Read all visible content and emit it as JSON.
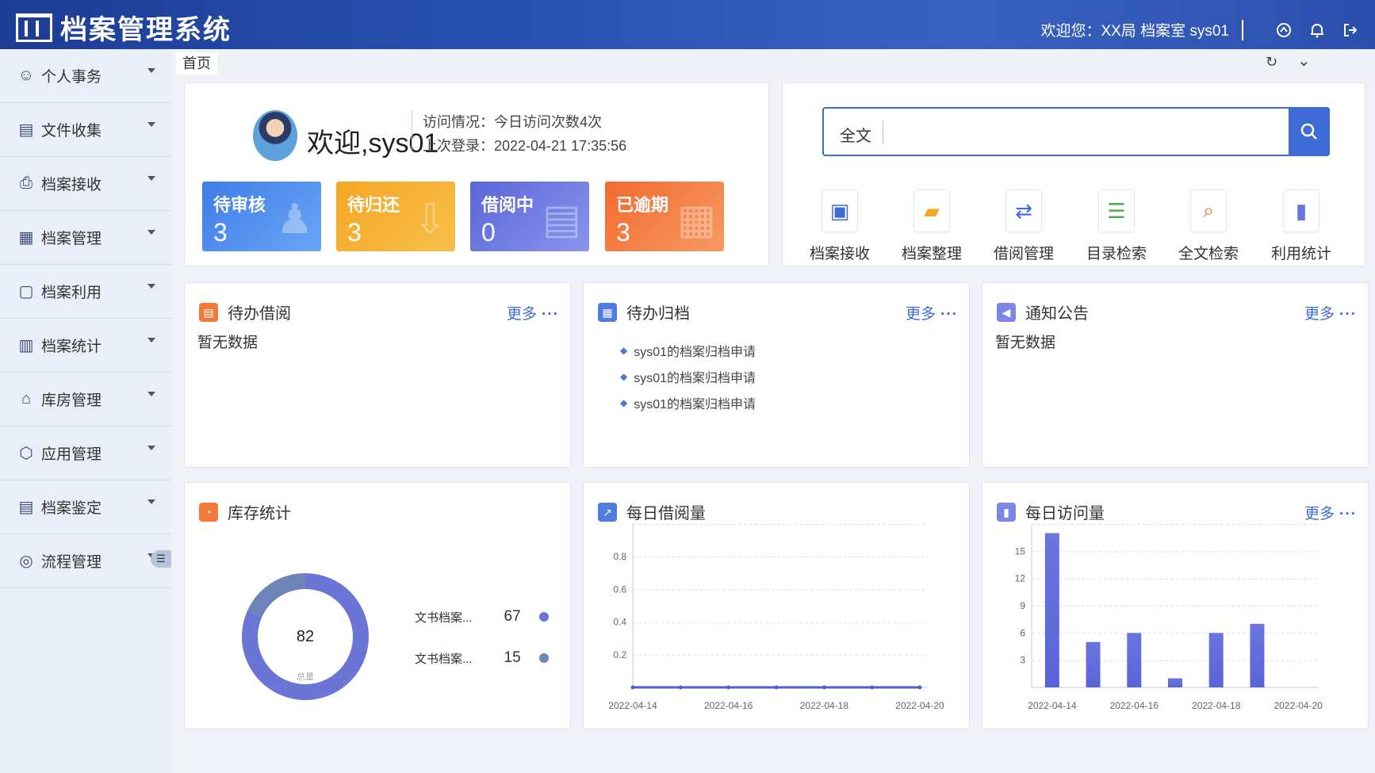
{
  "header": {
    "title": "档案管理系统",
    "greeting": "欢迎您：XX局 档案室 sys01"
  },
  "sidebar": {
    "items": [
      {
        "label": "个人事务",
        "icon": "user-group-icon"
      },
      {
        "label": "文件收集",
        "icon": "file-collect-icon"
      },
      {
        "label": "档案接收",
        "icon": "printer-icon"
      },
      {
        "label": "档案管理",
        "icon": "doc-manage-icon"
      },
      {
        "label": "档案利用",
        "icon": "doc-use-icon"
      },
      {
        "label": "档案统计",
        "icon": "doc-stat-icon"
      },
      {
        "label": "库房管理",
        "icon": "warehouse-icon"
      },
      {
        "label": "应用管理",
        "icon": "cube-icon"
      },
      {
        "label": "档案鉴定",
        "icon": "appraise-icon"
      },
      {
        "label": "流程管理",
        "icon": "process-icon"
      }
    ]
  },
  "tabs": {
    "home": "首页"
  },
  "welcome": {
    "text": "欢迎,sys01",
    "visit": "访问情况：今日访问次数4次",
    "last_login": "上次登录：2022-04-21 17:35:56"
  },
  "stats": [
    {
      "label": "待审核",
      "value": "3",
      "color": "#4f8ef0"
    },
    {
      "label": "待归还",
      "value": "3",
      "color": "#f5a623"
    },
    {
      "label": "借阅中",
      "value": "0",
      "color": "#6a75e0"
    },
    {
      "label": "已逾期",
      "value": "3",
      "color": "#f47a3c"
    }
  ],
  "search": {
    "scope": "全文"
  },
  "quick_links": [
    {
      "label": "档案接收",
      "icon": "inbox-icon",
      "color": "#3e6bd6"
    },
    {
      "label": "档案整理",
      "icon": "folder-icon",
      "color": "#f5a623"
    },
    {
      "label": "借阅管理",
      "icon": "borrow-icon",
      "color": "#3e6bd6"
    },
    {
      "label": "目录检索",
      "icon": "catalog-icon",
      "color": "#4caf50"
    },
    {
      "label": "全文检索",
      "icon": "fulltext-search-icon",
      "color": "#f47a3c"
    },
    {
      "label": "利用统计",
      "icon": "usage-stat-icon",
      "color": "#6a75e0"
    }
  ],
  "panels": {
    "pending_borrow": {
      "title": "待办借阅",
      "more": "更多",
      "empty": "暂无数据"
    },
    "pending_archive": {
      "title": "待办归档",
      "more": "更多",
      "items": [
        "sys01的档案归档申请",
        "sys01的档案归档申请",
        "sys01的档案归档申请"
      ]
    },
    "notice": {
      "title": "通知公告",
      "more": "更多",
      "empty": "暂无数据"
    },
    "inventory": {
      "title": "库存统计"
    },
    "daily_borrow": {
      "title": "每日借阅量"
    },
    "daily_visit": {
      "title": "每日访问量",
      "more": "更多"
    }
  },
  "chart_data": [
    {
      "type": "pie",
      "title": "库存统计",
      "center_value": 82,
      "center_label": "总量",
      "slices": [
        {
          "label": "文书档案...",
          "value": 67,
          "color": "#6a75d6"
        },
        {
          "label": "文书档案...",
          "value": 15,
          "color": "#6d84b8"
        }
      ]
    },
    {
      "type": "line",
      "title": "每日借阅量",
      "x": [
        "2022-04-14",
        "2022-04-15",
        "2022-04-16",
        "2022-04-17",
        "2022-04-18",
        "2022-04-19",
        "2022-04-20"
      ],
      "values": [
        0,
        0,
        0,
        0,
        0,
        0,
        0
      ],
      "x_tick_labels": [
        "2022-04-14",
        "2022-04-16",
        "2022-04-18",
        "2022-04-20"
      ],
      "y_ticks": [
        "0.2",
        "0.4",
        "0.6",
        "0.8"
      ],
      "ylim": [
        0,
        1
      ],
      "grid": true,
      "color": "#4a62d6"
    },
    {
      "type": "bar",
      "title": "每日访问量",
      "x": [
        "2022-04-14",
        "2022-04-15",
        "2022-04-16",
        "2022-04-17",
        "2022-04-18",
        "2022-04-19",
        "2022-04-20"
      ],
      "values": [
        17,
        5,
        6,
        1,
        6,
        7,
        0
      ],
      "x_tick_labels": [
        "2022-04-14",
        "2022-04-16",
        "2022-04-18",
        "2022-04-20"
      ],
      "y_ticks": [
        "3",
        "6",
        "9",
        "12",
        "15"
      ],
      "ylim": [
        0,
        18
      ],
      "grid": true,
      "color": "#6a75e0"
    }
  ]
}
